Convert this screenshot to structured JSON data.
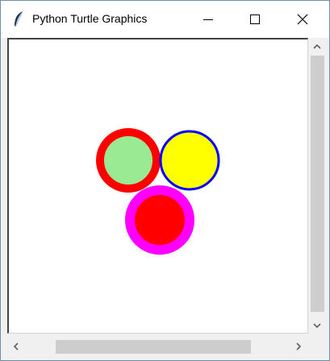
{
  "window": {
    "title": "Python Turtle Graphics",
    "icon": "feather-icon",
    "controls": [
      "minimize-icon",
      "maximize-icon",
      "close-icon"
    ]
  },
  "scrollbars": {
    "up_arrow": "▲",
    "down_arrow": "▼",
    "left_arrow": "◀",
    "right_arrow": "▶"
  },
  "drawing": {
    "circles": [
      {
        "name": "green-circle-red-outline",
        "fill": "#9aea94",
        "outline": "#ff0000"
      },
      {
        "name": "yellow-circle-blue-outline",
        "fill": "#ffff00",
        "outline": "#0000ff"
      },
      {
        "name": "red-circle-magenta-outline",
        "fill": "#ff0000",
        "outline": "#ff00ff"
      }
    ]
  }
}
